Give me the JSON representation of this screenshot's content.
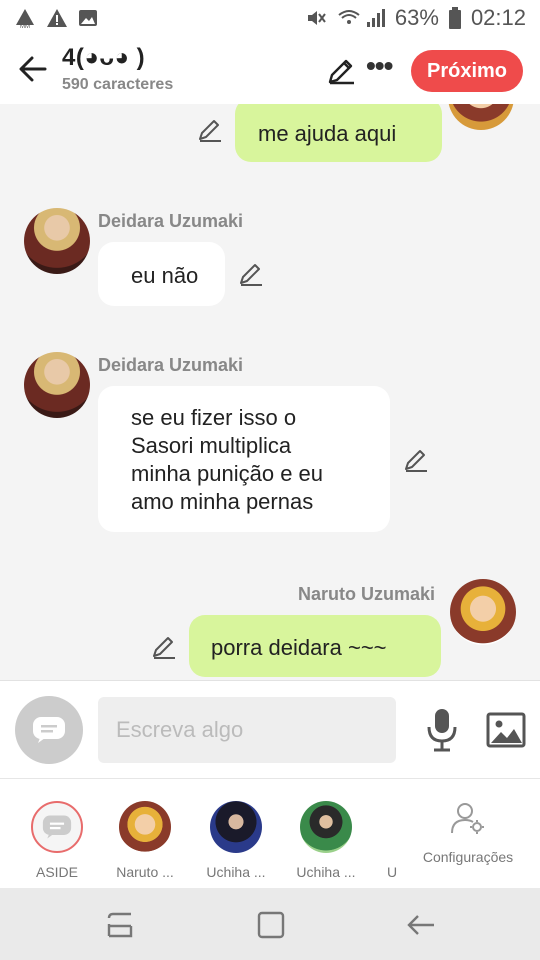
{
  "statusbar": {
    "battery": "63%",
    "time": "02:12"
  },
  "header": {
    "title": "4(◕ᴗ◕ )",
    "subtitle": "590 caracteres",
    "next_label": "Próximo"
  },
  "messages": {
    "m1": {
      "text": "me ajuda aqui"
    },
    "m2": {
      "name": "Deidara Uzumaki",
      "text": "eu não"
    },
    "m3": {
      "name": "Deidara Uzumaki",
      "lines": [
        "se eu fizer isso o",
        "Sasori multiplica",
        "minha punição e eu",
        "amo minha pernas"
      ]
    },
    "m4": {
      "name": "Naruto Uzumaki",
      "text": "porra deidara ~~~"
    }
  },
  "composer": {
    "placeholder": "Escreva algo"
  },
  "characters": [
    {
      "label": "ASIDE"
    },
    {
      "label": "Naruto ..."
    },
    {
      "label": "Uchiha ..."
    },
    {
      "label": "Uchiha ..."
    },
    {
      "label": "U"
    },
    {
      "label": "Configurações"
    }
  ]
}
